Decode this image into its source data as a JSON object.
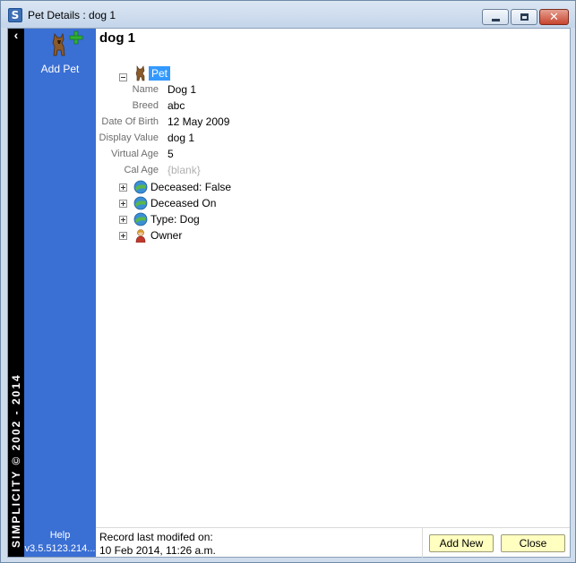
{
  "window": {
    "title": "Pet Details : dog 1",
    "app_icon_letter": "S"
  },
  "brand": {
    "back_glyph": "‹",
    "copyright": "SIMPLICITY © 2002 - 2014"
  },
  "sidebar": {
    "add_pet_label": "Add Pet",
    "help_label": "Help",
    "version": "v3.5.5123.214..."
  },
  "record": {
    "title": "dog 1"
  },
  "tree": {
    "root_label": "Pet",
    "properties": [
      {
        "label": "Name",
        "value": "Dog 1",
        "blank": false
      },
      {
        "label": "Breed",
        "value": "abc",
        "blank": false
      },
      {
        "label": "Date Of Birth",
        "value": "12 May 2009",
        "blank": false
      },
      {
        "label": "Display Value",
        "value": "dog 1",
        "blank": false
      },
      {
        "label": "Virtual Age",
        "value": "5",
        "blank": false
      },
      {
        "label": "Cal Age",
        "value": "{blank}",
        "blank": true
      }
    ],
    "children": [
      {
        "label": "Deceased:  False",
        "icon": "globe-icon"
      },
      {
        "label": "Deceased On",
        "icon": "globe-icon"
      },
      {
        "label": "Type:  Dog",
        "icon": "globe-icon"
      },
      {
        "label": "Owner",
        "icon": "person-icon"
      }
    ]
  },
  "status": {
    "label": "Record last modifed on:",
    "date": "10 Feb 2014, 11:26 a.m."
  },
  "buttons": {
    "add_new": "Add New",
    "close": "Close"
  },
  "colors": {
    "sidebar": "#3a6fd4",
    "selection": "#3399ff",
    "button_bg": "#ffffc0"
  }
}
